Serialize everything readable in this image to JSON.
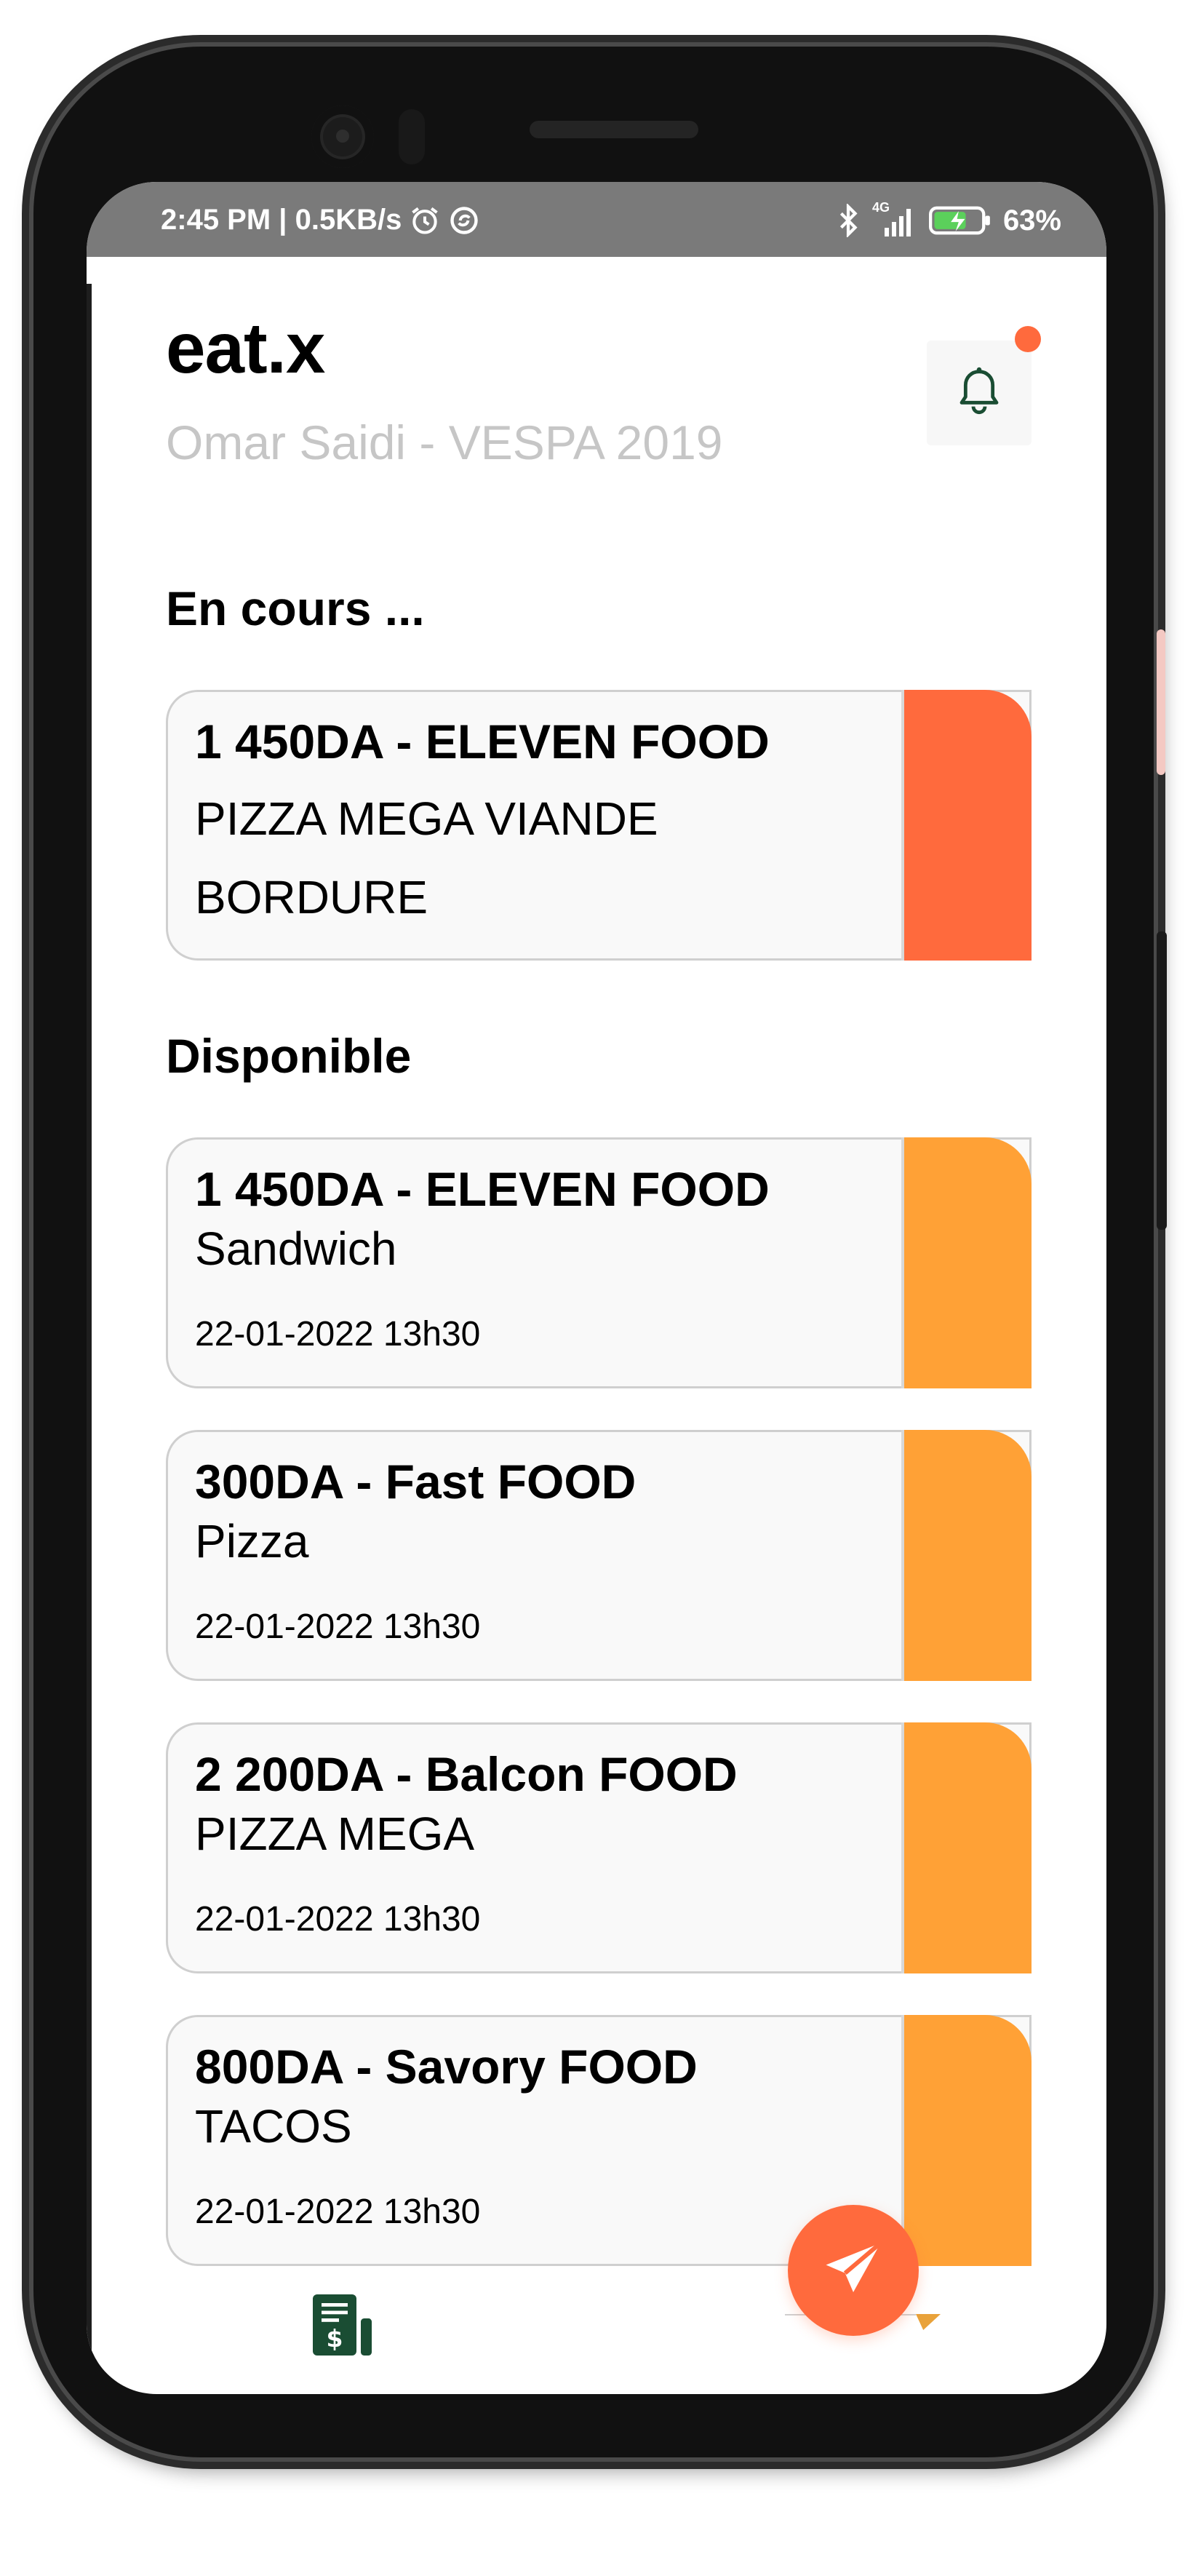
{
  "colors": {
    "accent_orange": "#ff6a3d",
    "accent_yellow": "#ffa136",
    "brand_green": "#1a4d33",
    "subtitle_gray": "#c6c6c6",
    "statusbar_gray": "#7a7a7a"
  },
  "statusbar": {
    "time_speed": "2:45 PM | 0.5KB/s",
    "network": "4G",
    "battery": "63%",
    "icons": [
      "alarm-icon",
      "sync-icon",
      "bluetooth-icon",
      "signal-icon",
      "battery-charging-icon"
    ]
  },
  "header": {
    "title": "eat.x",
    "subtitle": "Omar Saidi - VESPA 2019",
    "notification_icon": "bell-icon"
  },
  "sections": {
    "current": "En cours ...",
    "available": "Disponible"
  },
  "current_order": {
    "headline": "1 450DA - ELEVEN FOOD",
    "item": "PIZZA MEGA VIANDE BORDURE",
    "status_color": "#ff6a3d"
  },
  "available_orders": [
    {
      "headline": "1 450DA - ELEVEN FOOD",
      "item": "Sandwich",
      "date": "22-01-2022 13h30",
      "status_color": "#ffa136"
    },
    {
      "headline": "300DA - Fast FOOD",
      "item": "Pizza",
      "date": "22-01-2022 13h30",
      "status_color": "#ffa136"
    },
    {
      "headline": "2 200DA - Balcon FOOD",
      "item": "PIZZA MEGA",
      "date": "22-01-2022 13h30",
      "status_color": "#ffa136"
    },
    {
      "headline": "800DA - Savory FOOD",
      "item": "TACOS",
      "date": "22-01-2022 13h30",
      "status_color": "#ffa136"
    }
  ],
  "bottom_nav": {
    "invoice_icon": "invoice-dollar-icon",
    "fab_icon": "send-icon"
  }
}
